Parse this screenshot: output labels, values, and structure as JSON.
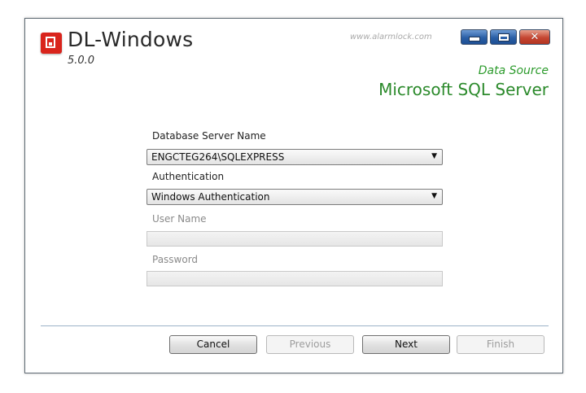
{
  "window": {
    "title": "DL-Windows",
    "version": "5.0.0",
    "brand_url": "www.alarmlock.com"
  },
  "data_source": {
    "caption": "Data Source",
    "name": "Microsoft SQL Server"
  },
  "form": {
    "server_label": "Database Server Name",
    "server_value": "ENGCTEG264\\SQLEXPRESS",
    "auth_label": "Authentication",
    "auth_value": "Windows Authentication",
    "username_label": "User Name",
    "username_value": "",
    "password_label": "Password",
    "password_value": ""
  },
  "buttons": {
    "cancel": "Cancel",
    "previous": "Previous",
    "next": "Next",
    "finish": "Finish"
  },
  "icons": {
    "app_logo": "app-logo-icon",
    "minimize": "minimize-icon",
    "maximize": "maximize-icon",
    "close": "close-icon",
    "dropdown": "chevron-down-icon"
  },
  "colors": {
    "accent_green": "#2b8a2b",
    "logo_red": "#d9241c",
    "close_red": "#c54632",
    "caption_blue": "#2a5fa6"
  }
}
